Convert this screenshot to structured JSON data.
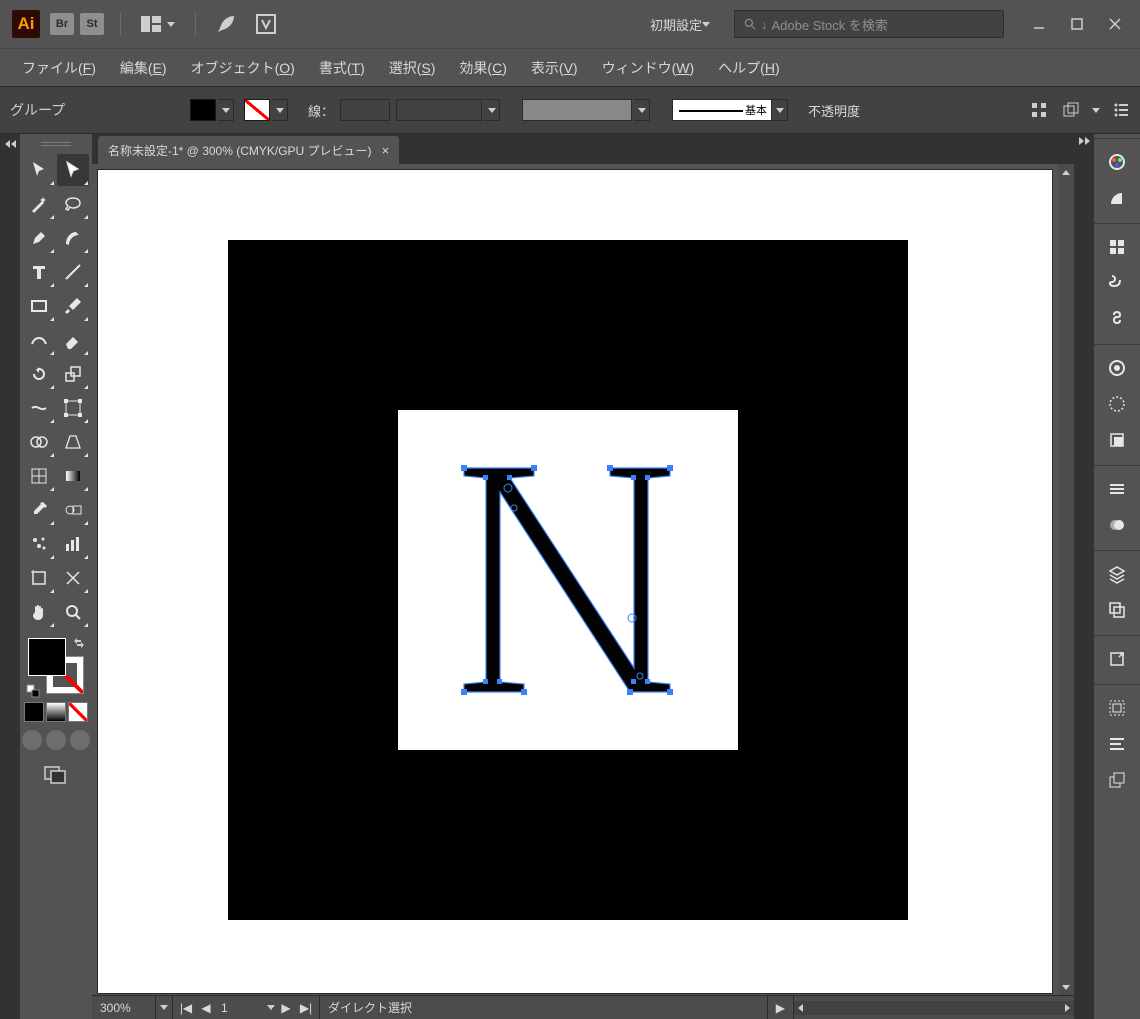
{
  "titlebar": {
    "logo": "Ai",
    "badges": [
      "Br",
      "St"
    ],
    "workspace_label": "初期設定",
    "search_placeholder": "Adobe Stock を検索"
  },
  "menu": {
    "items": [
      {
        "label": "ファイル",
        "key": "F"
      },
      {
        "label": "編集",
        "key": "E"
      },
      {
        "label": "オブジェクト",
        "key": "O"
      },
      {
        "label": "書式",
        "key": "T"
      },
      {
        "label": "選択",
        "key": "S"
      },
      {
        "label": "効果",
        "key": "C"
      },
      {
        "label": "表示",
        "key": "V"
      },
      {
        "label": "ウィンドウ",
        "key": "W"
      },
      {
        "label": "ヘルプ",
        "key": "H"
      }
    ]
  },
  "options": {
    "selection_name": "グループ",
    "stroke_label": "線：",
    "brush_label": "基本",
    "opacity_label": "不透明度"
  },
  "document": {
    "tab_title": "名称未設定-1* @ 300% (CMYK/GPU プレビュー)"
  },
  "status": {
    "zoom": "300%",
    "artboard": "1",
    "tool_status": "ダイレクト選択"
  }
}
